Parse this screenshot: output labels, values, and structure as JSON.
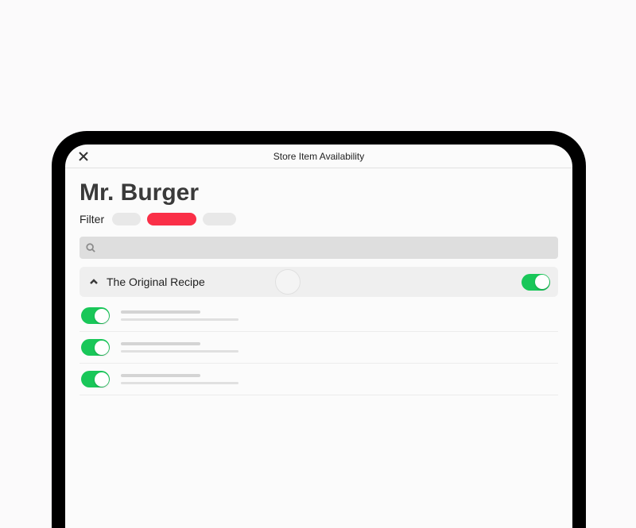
{
  "header": {
    "title": "Store Item Availability"
  },
  "store": {
    "name": "Mr. Burger"
  },
  "filter": {
    "label": "Filter",
    "chips": [
      {
        "active": false
      },
      {
        "active": true
      },
      {
        "active": false
      }
    ]
  },
  "category": {
    "name": "The Original Recipe",
    "toggle_on": true
  },
  "items": [
    {
      "toggle_on": true
    },
    {
      "toggle_on": true
    },
    {
      "toggle_on": true
    }
  ],
  "colors": {
    "accent_red": "#fa2f47",
    "toggle_green": "#19c759"
  }
}
